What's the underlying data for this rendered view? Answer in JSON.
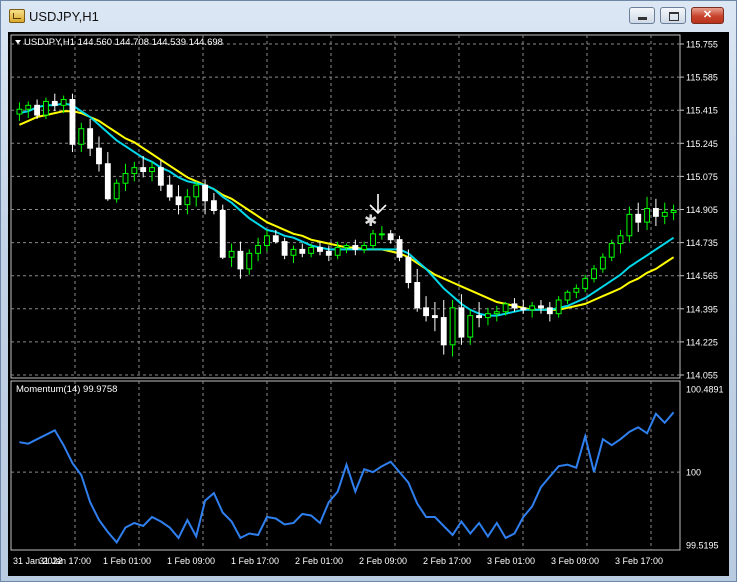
{
  "window": {
    "title": "USDJPY,H1",
    "controls": {
      "minimize": "",
      "maximize": "",
      "close": "✕"
    }
  },
  "main_chart": {
    "header": "USDJPY,H1  144.560 144.708 144.539 144.698",
    "price_ticks": [
      "115.755",
      "115.585",
      "115.415",
      "115.245",
      "115.075",
      "114.905",
      "114.735",
      "114.565",
      "114.395",
      "114.225",
      "114.055"
    ],
    "colors": {
      "bull": "#00ff00",
      "bear": "#ffffff",
      "ma_fast": "#00d7e8",
      "ma_slow": "#ffff00",
      "grid": "#8a8a8a",
      "text": "#ffffff",
      "arrow": "#ffffff"
    }
  },
  "momentum": {
    "header": "Momentum(14) 99.9758",
    "ticks": [
      "100.4891",
      "100",
      "99.5195"
    ],
    "line_color": "#2f7fef"
  },
  "time_labels": [
    "31 Jan 2022",
    "31 Jan 17:00",
    "1 Feb 01:00",
    "1 Feb 09:00",
    "1 Feb 17:00",
    "2 Feb 01:00",
    "2 Feb 09:00",
    "2 Feb 17:00",
    "3 Feb 01:00",
    "3 Feb 09:00",
    "3 Feb 17:00"
  ],
  "chart_data": [
    {
      "type": "candlestick",
      "title": "USDJPY,H1",
      "ylim": [
        114.055,
        115.755
      ],
      "grid": true,
      "series": [
        {
          "name": "price",
          "values": [
            [
              115.395,
              115.455,
              115.36,
              115.42
            ],
            [
              115.42,
              115.46,
              115.375,
              115.44
            ],
            [
              115.44,
              115.47,
              115.37,
              115.39
            ],
            [
              115.39,
              115.48,
              115.37,
              115.46
            ],
            [
              115.46,
              115.5,
              115.41,
              115.44
            ],
            [
              115.44,
              115.49,
              115.4,
              115.47
            ],
            [
              115.47,
              115.5,
              115.2,
              115.24
            ],
            [
              115.24,
              115.35,
              115.2,
              115.32
            ],
            [
              115.32,
              115.37,
              115.18,
              115.22
            ],
            [
              115.22,
              115.28,
              115.1,
              115.14
            ],
            [
              115.14,
              115.2,
              114.95,
              114.96
            ],
            [
              114.96,
              115.06,
              114.94,
              115.04
            ],
            [
              115.04,
              115.14,
              115.0,
              115.09
            ],
            [
              115.09,
              115.15,
              115.05,
              115.12
            ],
            [
              115.12,
              115.18,
              115.07,
              115.1
            ],
            [
              115.1,
              115.15,
              115.05,
              115.12
            ],
            [
              115.12,
              115.16,
              115.0,
              115.03
            ],
            [
              115.03,
              115.08,
              114.95,
              114.97
            ],
            [
              114.97,
              115.03,
              114.88,
              114.93
            ],
            [
              114.93,
              115.01,
              114.88,
              114.97
            ],
            [
              114.97,
              115.05,
              114.92,
              115.03
            ],
            [
              115.03,
              115.06,
              114.88,
              114.95
            ],
            [
              114.95,
              114.99,
              114.88,
              114.9
            ],
            [
              114.9,
              114.93,
              114.65,
              114.66
            ],
            [
              114.66,
              114.73,
              114.61,
              114.69
            ],
            [
              114.69,
              114.74,
              114.55,
              114.6
            ],
            [
              114.6,
              114.7,
              114.57,
              114.68
            ],
            [
              114.68,
              114.76,
              114.64,
              114.72
            ],
            [
              114.72,
              114.8,
              114.69,
              114.77
            ],
            [
              114.77,
              114.8,
              114.73,
              114.74
            ],
            [
              114.74,
              114.76,
              114.65,
              114.67
            ],
            [
              114.67,
              114.72,
              114.63,
              114.7
            ],
            [
              114.7,
              114.73,
              114.66,
              114.68
            ],
            [
              114.68,
              114.73,
              114.66,
              114.71
            ],
            [
              114.71,
              114.74,
              114.67,
              114.69
            ],
            [
              114.69,
              114.72,
              114.64,
              114.67
            ],
            [
              114.67,
              114.74,
              114.65,
              114.71
            ],
            [
              114.71,
              114.73,
              114.68,
              114.72
            ],
            [
              114.72,
              114.75,
              114.67,
              114.7
            ],
            [
              114.7,
              114.74,
              114.68,
              114.72
            ],
            [
              114.72,
              114.8,
              114.7,
              114.78
            ],
            [
              114.78,
              114.82,
              114.75,
              114.78
            ],
            [
              114.78,
              114.8,
              114.73,
              114.75
            ],
            [
              114.75,
              114.77,
              114.64,
              114.66
            ],
            [
              114.66,
              114.7,
              114.5,
              114.53
            ],
            [
              114.53,
              114.6,
              114.38,
              114.4
            ],
            [
              114.4,
              114.46,
              114.33,
              114.36
            ],
            [
              114.36,
              114.43,
              114.28,
              114.35
            ],
            [
              114.35,
              114.44,
              114.16,
              114.21
            ],
            [
              114.21,
              114.44,
              114.15,
              114.4
            ],
            [
              114.4,
              114.47,
              114.21,
              114.25
            ],
            [
              114.25,
              114.39,
              114.21,
              114.36
            ],
            [
              114.36,
              114.43,
              114.3,
              114.35
            ],
            [
              114.35,
              114.4,
              114.31,
              114.37
            ],
            [
              114.37,
              114.41,
              114.33,
              114.38
            ],
            [
              114.38,
              114.43,
              114.36,
              114.42
            ],
            [
              114.42,
              114.45,
              114.38,
              114.4
            ],
            [
              114.4,
              114.44,
              114.37,
              114.39
            ],
            [
              114.39,
              114.43,
              114.35,
              114.41
            ],
            [
              114.41,
              114.44,
              114.37,
              114.4
            ],
            [
              114.4,
              114.43,
              114.33,
              114.37
            ],
            [
              114.37,
              114.46,
              114.35,
              114.44
            ],
            [
              114.44,
              114.49,
              114.42,
              114.48
            ],
            [
              114.48,
              114.52,
              114.45,
              114.5
            ],
            [
              114.5,
              114.57,
              114.48,
              114.55
            ],
            [
              114.55,
              114.62,
              114.53,
              114.6
            ],
            [
              114.6,
              114.68,
              114.58,
              114.66
            ],
            [
              114.66,
              114.75,
              114.64,
              114.73
            ],
            [
              114.73,
              114.8,
              114.68,
              114.77
            ],
            [
              114.77,
              114.92,
              114.74,
              114.88
            ],
            [
              114.88,
              114.94,
              114.79,
              114.84
            ],
            [
              114.84,
              114.97,
              114.8,
              114.91
            ],
            [
              114.91,
              114.96,
              114.82,
              114.87
            ],
            [
              114.87,
              114.94,
              114.83,
              114.89
            ],
            [
              114.89,
              114.93,
              114.85,
              114.9
            ]
          ]
        },
        {
          "name": "MA fast",
          "values": [
            115.4,
            115.41,
            115.43,
            115.44,
            115.44,
            115.45,
            115.44,
            115.41,
            115.38,
            115.34,
            115.3,
            115.26,
            115.23,
            115.2,
            115.17,
            115.15,
            115.12,
            115.1,
            115.07,
            115.05,
            115.04,
            115.03,
            115.01,
            114.97,
            114.94,
            114.9,
            114.86,
            114.83,
            114.8,
            114.79,
            114.77,
            114.76,
            114.74,
            114.72,
            114.71,
            114.7,
            114.7,
            114.7,
            114.7,
            114.7,
            114.7,
            114.7,
            114.7,
            114.7,
            114.68,
            114.64,
            114.6,
            114.55,
            114.5,
            114.46,
            114.42,
            114.39,
            114.37,
            114.36,
            114.36,
            114.37,
            114.38,
            114.39,
            114.39,
            114.39,
            114.39,
            114.4,
            114.41,
            114.43,
            114.45,
            114.48,
            114.51,
            114.54,
            114.57,
            114.61,
            114.64,
            114.67,
            114.7,
            114.73,
            114.76
          ]
        },
        {
          "name": "MA slow",
          "values": [
            115.34,
            115.36,
            115.38,
            115.39,
            115.4,
            115.41,
            115.41,
            115.4,
            115.38,
            115.36,
            115.33,
            115.3,
            115.27,
            115.25,
            115.22,
            115.19,
            115.16,
            115.13,
            115.1,
            115.07,
            115.05,
            115.03,
            115.01,
            114.98,
            114.96,
            114.93,
            114.9,
            114.87,
            114.84,
            114.82,
            114.8,
            114.78,
            114.77,
            114.75,
            114.74,
            114.73,
            114.72,
            114.71,
            114.71,
            114.7,
            114.7,
            114.7,
            114.69,
            114.68,
            114.66,
            114.63,
            114.6,
            114.57,
            114.55,
            114.53,
            114.51,
            114.49,
            114.47,
            114.45,
            114.43,
            114.42,
            114.41,
            114.4,
            114.39,
            114.39,
            114.39,
            114.39,
            114.4,
            114.41,
            114.42,
            114.44,
            114.46,
            114.48,
            114.5,
            114.53,
            114.55,
            114.58,
            114.6,
            114.63,
            114.66
          ]
        }
      ]
    },
    {
      "type": "line",
      "title": "Momentum(14) 99.9758",
      "ylim": [
        99.5195,
        100.4891
      ],
      "grid": true,
      "series": [
        {
          "name": "Momentum(14)",
          "values": [
            100.2,
            100.19,
            100.22,
            100.25,
            100.28,
            100.18,
            100.06,
            99.98,
            99.8,
            99.68,
            99.6,
            99.53,
            99.63,
            99.66,
            99.64,
            99.7,
            99.67,
            99.63,
            99.56,
            99.68,
            99.57,
            99.81,
            99.86,
            99.73,
            99.67,
            99.56,
            99.59,
            99.58,
            99.7,
            99.69,
            99.65,
            99.66,
            99.72,
            99.71,
            99.66,
            99.8,
            99.87,
            100.05,
            99.87,
            100.02,
            100.0,
            100.04,
            100.07,
            100.0,
            99.93,
            99.79,
            99.7,
            99.7,
            99.64,
            99.58,
            99.67,
            99.59,
            99.66,
            99.57,
            99.66,
            99.56,
            99.59,
            99.7,
            99.77,
            99.9,
            99.97,
            100.04,
            100.05,
            100.03,
            100.24,
            100.0,
            100.22,
            100.18,
            100.22,
            100.27,
            100.3,
            100.26,
            100.39,
            100.33,
            100.4
          ]
        }
      ]
    }
  ]
}
